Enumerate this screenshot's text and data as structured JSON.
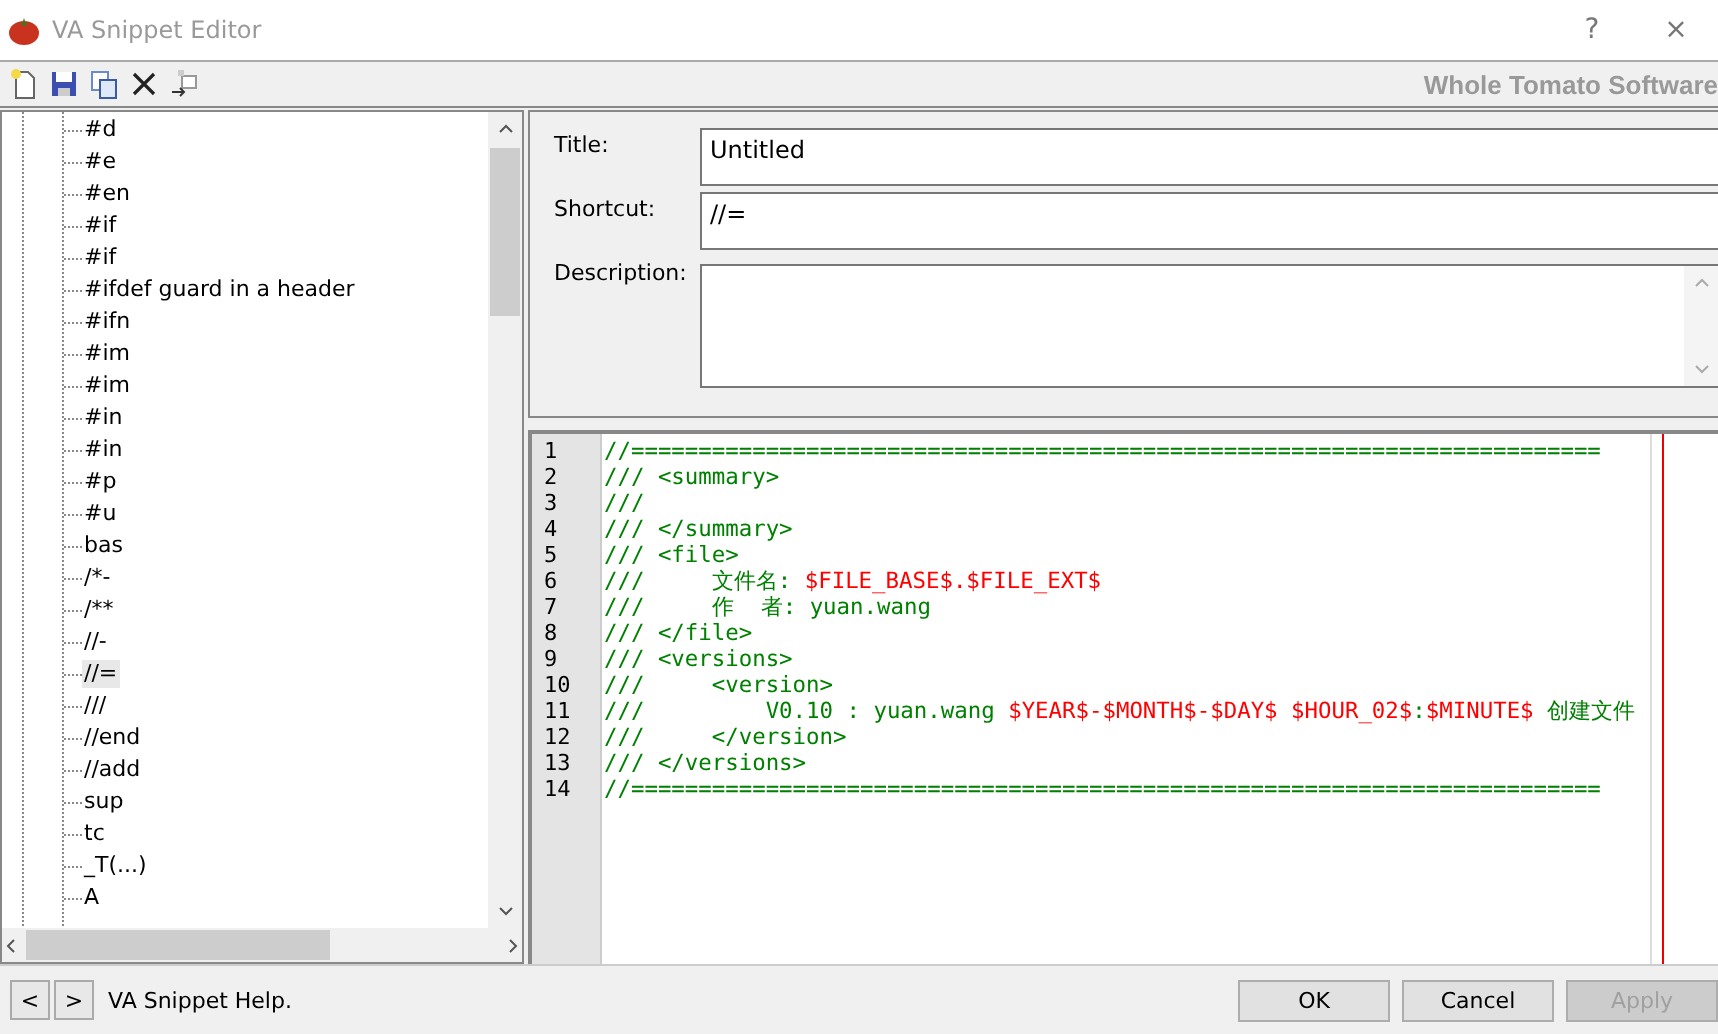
{
  "window": {
    "title": "VA Snippet Editor",
    "help_button": "?",
    "close_button": "×"
  },
  "toolbar": {
    "brand": "Whole Tomato Software"
  },
  "snippet_tree": {
    "items": [
      {
        "label": "#d",
        "selected": false
      },
      {
        "label": "#e",
        "selected": false
      },
      {
        "label": "#en",
        "selected": false
      },
      {
        "label": "#if",
        "selected": false
      },
      {
        "label": "#if",
        "selected": false
      },
      {
        "label": "#ifdef guard in a header",
        "selected": false
      },
      {
        "label": "#ifn",
        "selected": false
      },
      {
        "label": "#im",
        "selected": false
      },
      {
        "label": "#im",
        "selected": false
      },
      {
        "label": "#in",
        "selected": false
      },
      {
        "label": "#in",
        "selected": false
      },
      {
        "label": "#p",
        "selected": false
      },
      {
        "label": "#u",
        "selected": false
      },
      {
        "label": "bas",
        "selected": false
      },
      {
        "label": "/*-",
        "selected": false
      },
      {
        "label": "/**",
        "selected": false
      },
      {
        "label": "//-",
        "selected": false
      },
      {
        "label": "//=",
        "selected": true
      },
      {
        "label": "///",
        "selected": false
      },
      {
        "label": "//end",
        "selected": false
      },
      {
        "label": "//add",
        "selected": false
      },
      {
        "label": "sup",
        "selected": false
      },
      {
        "label": "tc",
        "selected": false
      },
      {
        "label": "_T(...)",
        "selected": false
      },
      {
        "label": "A",
        "selected": false
      }
    ]
  },
  "form": {
    "fields": [
      {
        "label": "Title:",
        "value": "Untitled",
        "kind": "line"
      },
      {
        "label": "Shortcut:",
        "value": "//=",
        "kind": "line"
      },
      {
        "label": "Description:",
        "kind": "multiline"
      }
    ]
  },
  "code_editor": {
    "lines": [
      {
        "number": "1",
        "segments": [
          {
            "text": "//========================================================================",
            "kind": "comment"
          }
        ]
      },
      {
        "number": "2",
        "segments": [
          {
            "text": "/// <summary>",
            "kind": "comment"
          }
        ]
      },
      {
        "number": "3",
        "segments": [
          {
            "text": "///",
            "kind": "comment"
          }
        ]
      },
      {
        "number": "4",
        "segments": [
          {
            "text": "/// </summary>",
            "kind": "comment"
          }
        ]
      },
      {
        "number": "5",
        "segments": [
          {
            "text": "/// <file>",
            "kind": "comment"
          }
        ]
      },
      {
        "number": "6",
        "segments": [
          {
            "text": "///     文件名: ",
            "kind": "comment"
          },
          {
            "text": "$FILE_BASE$.$FILE_EXT$",
            "kind": "macro"
          }
        ]
      },
      {
        "number": "7",
        "segments": [
          {
            "text": "///     作  者: yuan.wang",
            "kind": "comment"
          }
        ]
      },
      {
        "number": "8",
        "segments": [
          {
            "text": "/// </file>",
            "kind": "comment"
          }
        ]
      },
      {
        "number": "9",
        "segments": [
          {
            "text": "/// <versions>",
            "kind": "comment"
          }
        ]
      },
      {
        "number": "10",
        "segments": [
          {
            "text": "///     <version>",
            "kind": "comment"
          }
        ]
      },
      {
        "number": "11",
        "segments": [
          {
            "text": "///         V0.10 : yuan.wang ",
            "kind": "comment"
          },
          {
            "text": "$YEAR$-$MONTH$-$DAY$ $HOUR_02$",
            "kind": "macro"
          },
          {
            "text": ":",
            "kind": "comment"
          },
          {
            "text": "$MINUTE$",
            "kind": "macro"
          },
          {
            "text": " 创建文件",
            "kind": "comment"
          }
        ]
      },
      {
        "number": "12",
        "segments": [
          {
            "text": "///     </version>",
            "kind": "comment"
          }
        ]
      },
      {
        "number": "13",
        "segments": [
          {
            "text": "/// </versions>",
            "kind": "comment"
          }
        ]
      },
      {
        "number": "14",
        "segments": [
          {
            "text": "//========================================================================",
            "kind": "comment"
          }
        ]
      }
    ]
  },
  "footer": {
    "nav": [
      "<",
      ">"
    ],
    "help_text": "VA Snippet Help.",
    "buttons": [
      {
        "label": "OK",
        "disabled": false
      },
      {
        "label": "Cancel",
        "disabled": false
      },
      {
        "label": "Apply",
        "disabled": true
      }
    ]
  }
}
